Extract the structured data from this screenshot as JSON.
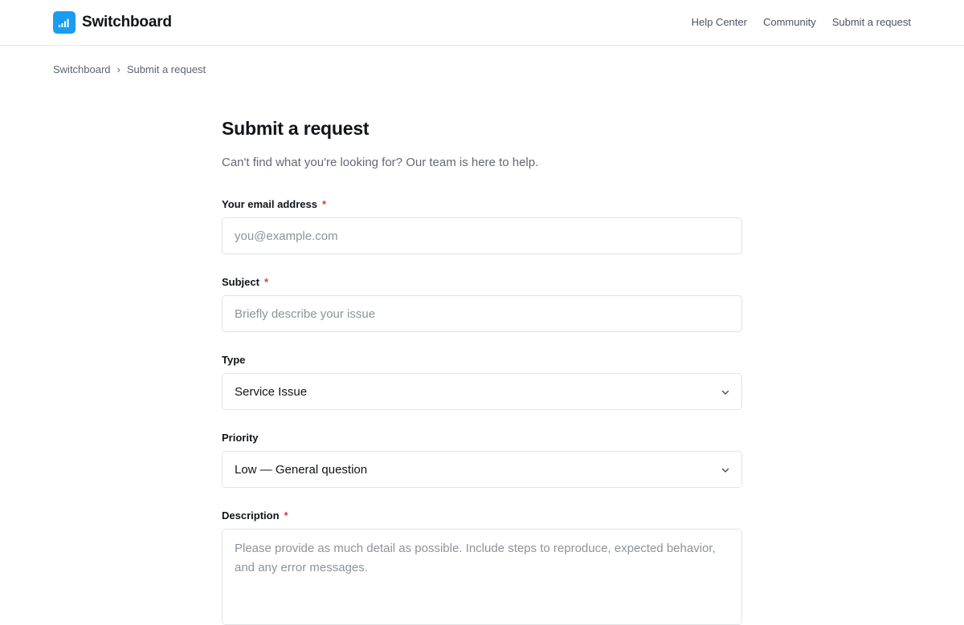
{
  "header": {
    "brand_name": "Switchboard",
    "brand_icon": "signal-bars-icon",
    "brand_color": "#1a9df0",
    "nav": [
      {
        "label": "Help Center"
      },
      {
        "label": "Community"
      },
      {
        "label": "Submit a request"
      }
    ]
  },
  "breadcrumb": {
    "items": [
      {
        "label": "Switchboard"
      },
      {
        "label": "Submit a request"
      }
    ],
    "separator": "›"
  },
  "main": {
    "title": "Submit a request",
    "subtitle": "Can't find what you're looking for? Our team is here to help.",
    "required_marker": "*",
    "fields": {
      "email": {
        "label": "Your email address",
        "placeholder": "you@example.com",
        "value": ""
      },
      "subject": {
        "label": "Subject",
        "placeholder": "Briefly describe your issue",
        "value": ""
      },
      "type": {
        "label": "Type",
        "selected": "Service Issue"
      },
      "priority": {
        "label": "Priority",
        "selected": "Low — General question"
      },
      "description": {
        "label": "Description",
        "placeholder": "Please provide as much detail as possible. Include steps to reproduce, expected behavior, and any error messages.",
        "value": ""
      }
    }
  }
}
